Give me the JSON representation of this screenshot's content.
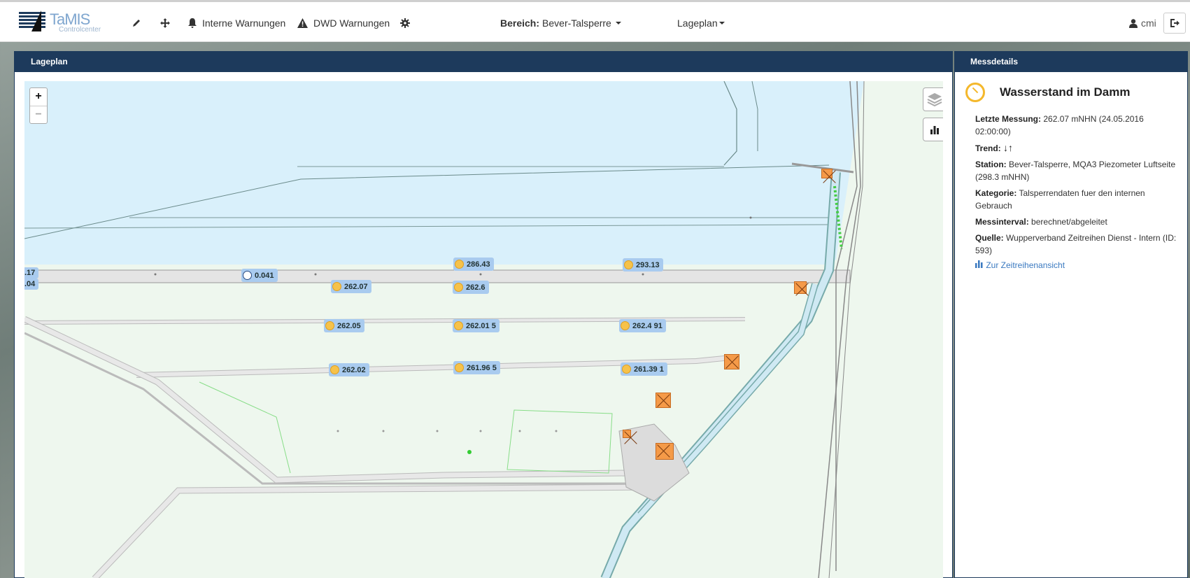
{
  "app": {
    "logo_text": "TaMIS",
    "logo_sub": "Controlcenter"
  },
  "nav": {
    "internal_warnings": "Interne Warnungen",
    "dwd_warnings": "DWD Warnungen",
    "area_label": "Bereich:",
    "area_value": "Bever-Talsperre",
    "view": "Lageplan",
    "user": "cmi"
  },
  "icons": {
    "edit": "pencil-icon",
    "move": "move-icon",
    "bell": "bell-icon",
    "warning": "warning-triangle-icon",
    "settings": "gear-icon",
    "user": "user-icon",
    "logout": "logout-icon",
    "layers": "layers-icon",
    "chart": "bar-chart-icon"
  },
  "map_panel": {
    "title": "Lageplan",
    "zoom_in": "+",
    "zoom_out": "−",
    "markers": [
      {
        "id": "m1",
        "value": ".17",
        "gauge": "none"
      },
      {
        "id": "m2",
        "value": ".04",
        "gauge": "none"
      },
      {
        "id": "m3",
        "value": "0.041",
        "gauge": "blue"
      },
      {
        "id": "m4",
        "value": "286.43",
        "gauge": "yellow"
      },
      {
        "id": "m5",
        "value": "293.13",
        "gauge": "yellow"
      },
      {
        "id": "m6",
        "value": "262.07",
        "gauge": "yellow"
      },
      {
        "id": "m7",
        "value": "262.6",
        "gauge": "yellow"
      },
      {
        "id": "m8",
        "value": "262.05",
        "gauge": "yellow"
      },
      {
        "id": "m9",
        "value": "262.01 5",
        "gauge": "yellow"
      },
      {
        "id": "m10",
        "value": "262.4 91",
        "gauge": "yellow"
      },
      {
        "id": "m11",
        "value": "262.02",
        "gauge": "yellow"
      },
      {
        "id": "m12",
        "value": "261.96 5",
        "gauge": "yellow"
      },
      {
        "id": "m13",
        "value": "261.39 1",
        "gauge": "yellow"
      }
    ],
    "colors": {
      "water": "#d9f0fb",
      "land": "#eef7ee",
      "road": "#e4e4e4",
      "marker": "#a9cbef",
      "building": "#f59a48"
    }
  },
  "details_panel": {
    "header": "Messdetails",
    "title": "Wasserstand im Damm",
    "last_label": "Letzte Messung:",
    "last_value": "262.07 mNHN (24.05.2016 02:00:00)",
    "trend_label": "Trend:",
    "trend_value": "↓↑",
    "station_label": "Station:",
    "station_value": "Bever-Talsperre, MQA3 Piezometer Luftseite (298.3 mNHN)",
    "category_label": "Kategorie:",
    "category_value": "Talsperrendaten fuer den internen Gebrauch",
    "interval_label": "Messinterval:",
    "interval_value": "berechnet/abgeleitet",
    "source_label": "Quelle:",
    "source_value": "Wupperverband Zeitreihen Dienst - Intern (ID: 593)",
    "link": "Zur Zeitreihenansicht"
  }
}
